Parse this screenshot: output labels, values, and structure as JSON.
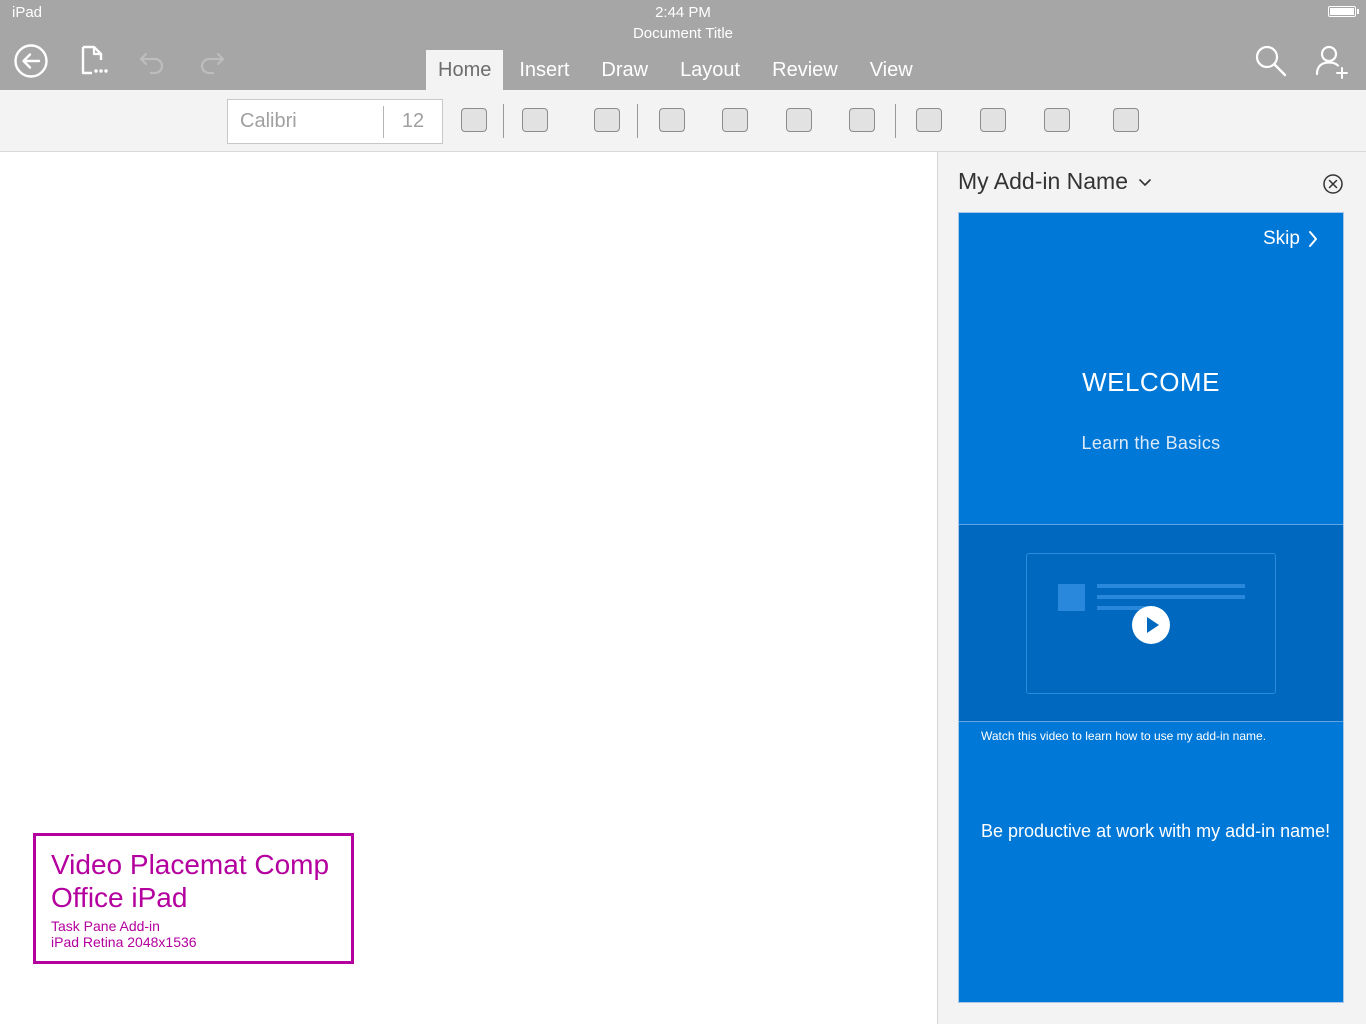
{
  "status": {
    "device": "iPad",
    "time": "2:44 PM"
  },
  "document": {
    "title": "Document Title"
  },
  "toolbar": {
    "back_icon": "back-arrow-icon",
    "file_icon": "file-options-icon",
    "undo_icon": "undo-icon",
    "redo_icon": "redo-icon",
    "search_icon": "search-icon",
    "share_icon": "add-person-icon"
  },
  "tabs": [
    {
      "label": "Home",
      "active": true
    },
    {
      "label": "Insert",
      "active": false
    },
    {
      "label": "Draw",
      "active": false
    },
    {
      "label": "Layout",
      "active": false
    },
    {
      "label": "Review",
      "active": false
    },
    {
      "label": "View",
      "active": false
    }
  ],
  "ribbon": {
    "font_name": "Calibri",
    "font_size": "12"
  },
  "placemat": {
    "title_line1": "Video Placemat Comp",
    "title_line2": "Office iPad",
    "sub_line1": "Task Pane Add-in",
    "sub_line2": "iPad Retina 2048x1536"
  },
  "task_pane": {
    "title": "My Add-in Name",
    "skip_label": "Skip",
    "welcome": "WELCOME",
    "learn": "Learn the Basics",
    "caption": "Watch this video to learn how to use my add-in name.",
    "productive": "Be productive at work with my add-in name!"
  },
  "colors": {
    "topbar": "#a6a6a6",
    "ribbon": "#f3f3f3",
    "accent_blue": "#0078d7",
    "video_band": "#0068bf",
    "placemat_magenta": "#b4009e"
  }
}
